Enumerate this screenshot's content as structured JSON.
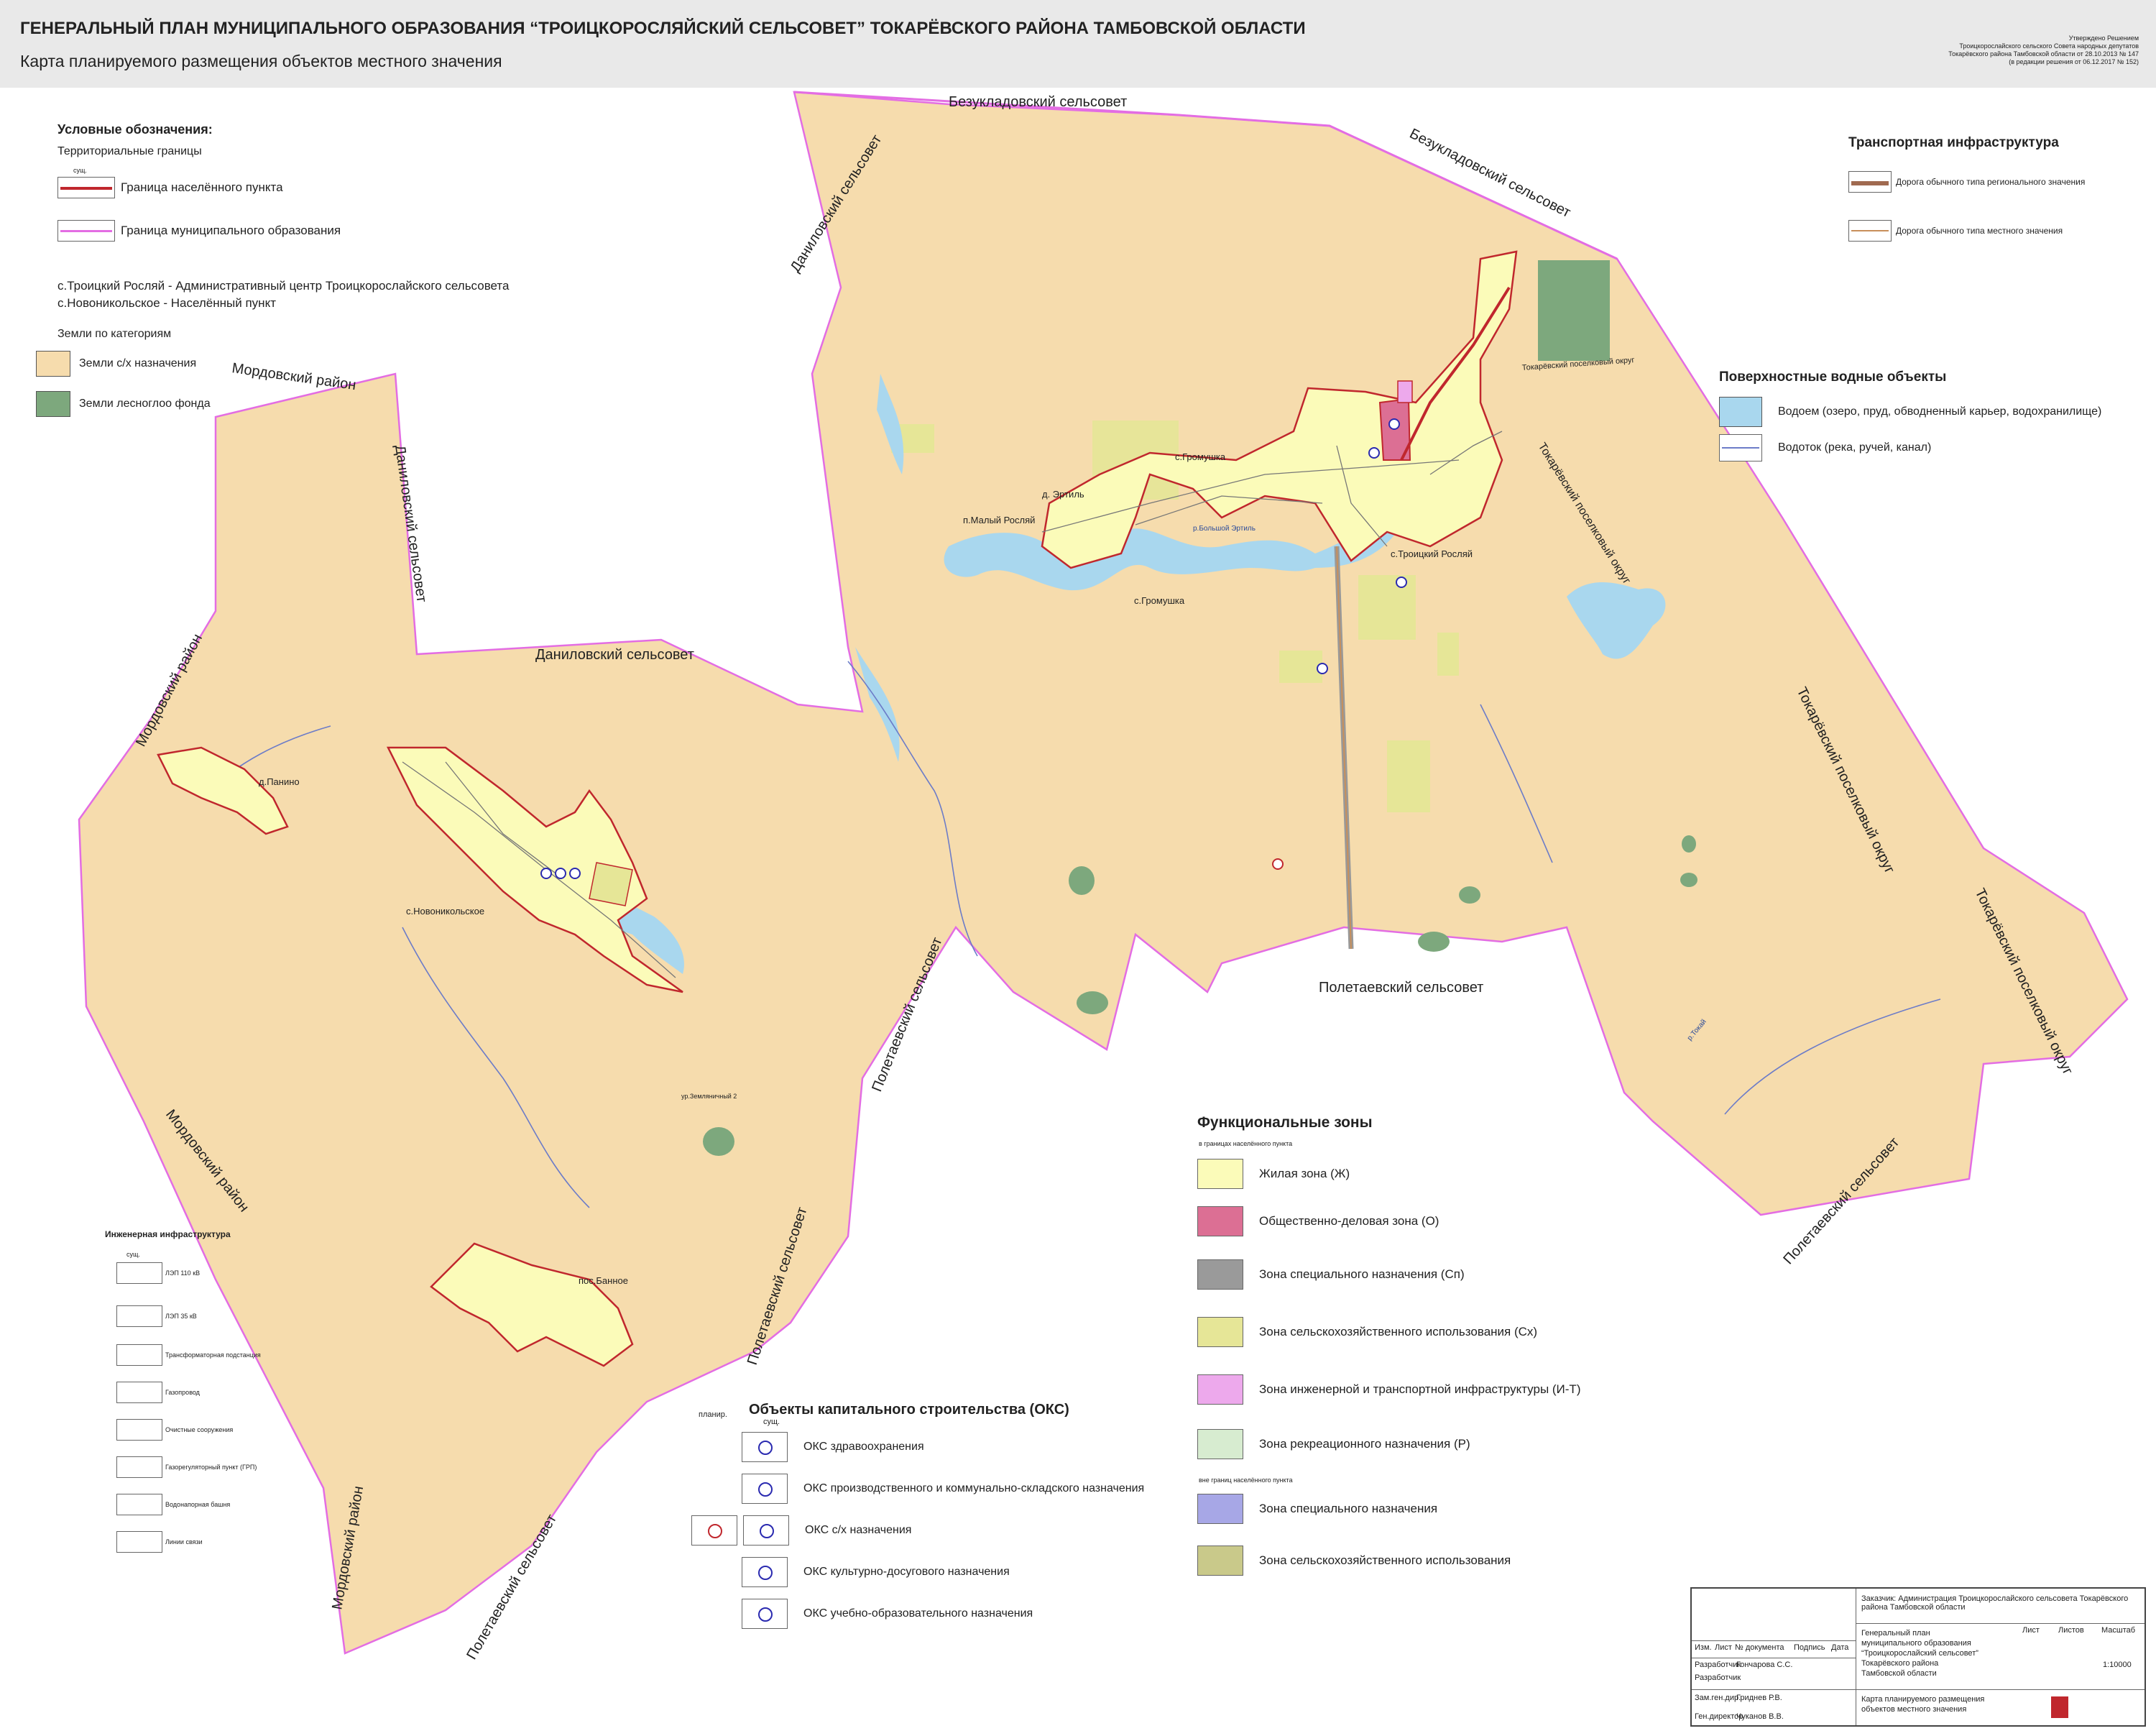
{
  "header": {
    "title": "ГЕНЕРАЛЬНЫЙ ПЛАН МУНИЦИПАЛЬНОГО ОБРАЗОВАНИЯ “ТРОИЦКОРОСЛЯЙСКИЙ СЕЛЬСОВЕТ” ТОКАРЁВСКОГО РАЙОНА ТАМБОВСКОЙ ОБЛАСТИ",
    "subtitle": "Карта планируемого размещения объектов местного значения",
    "approval": [
      "Утверждено Решением",
      "Троицкорослайского сельского Совета народных депутатов",
      "Токарёвского района Тамбовской области от 28.10.2013 № 147",
      "(в редакции решения от 06.12.2017 № 152)"
    ]
  },
  "legend_left": {
    "heading": "Условные обозначения:",
    "territorial": "Территориальные границы",
    "col_note": "сущ.",
    "settlement_border": "Граница населённого пункта",
    "municipal_border": "Граница муниципального образования",
    "center_note": "с.Троицкий Росляй - Административный центр Троицкорослайского сельсовета",
    "settlement_note": "с.Новоникольское - Населённый пункт",
    "land_heading": "Земли по категориям",
    "agri_land": "Земли с/х назначения",
    "forest_land": "Земли лесноглоо фонда"
  },
  "transport": {
    "heading": "Транспортная инфраструктура",
    "regional_road": "Дорога обычного типа регионального значения",
    "local_road": "Дорога обычного типа местного значения"
  },
  "water": {
    "heading": "Поверхностные водные объекты",
    "reservoir": "Водоем (озеро, пруд, обводненный карьер, водохранилище)",
    "stream": "Водоток (река, ручей, канал)"
  },
  "zones": {
    "heading": "Функциональные зоны",
    "inside_note": "в границах населённого пункта",
    "outside_note": "вне границ населённого пункта",
    "items": [
      {
        "label": "Жилая зона (Ж)",
        "color": "#fbfbb9"
      },
      {
        "label": "Общественно-деловая зона (О)",
        "color": "#dc6f94"
      },
      {
        "label": "Зона специального назначения (Сп)",
        "color": "#9a9a9a"
      },
      {
        "label": "Зона сельскохозяйственного использования (Сх)",
        "color": "#e6e697"
      },
      {
        "label": "Зона инженерной и транспортной инфраструктуры (И-Т)",
        "color": "#eda9ec"
      },
      {
        "label": "Зона рекреационного назначения (Р)",
        "color": "#d7ecd0"
      }
    ],
    "outside_items": [
      {
        "label": "Зона специального назначения",
        "color": "#a7a7e6"
      },
      {
        "label": "Зона сельскохозяйственного использования",
        "color": "#c9c98a"
      }
    ]
  },
  "oks": {
    "heading": "Объекты капитального строительства (ОКС)",
    "planned": "планир.",
    "existing": "сущ.",
    "items": [
      "ОКС здравоохранения",
      "ОКС производственного и коммунально-складского назначения",
      "ОКС с/х назначения",
      "ОКС культурно-досугового назначения",
      "ОКС учебно-образовательного назначения"
    ]
  },
  "engineering": {
    "heading": "Инженерная инфраструктура",
    "col": "сущ.",
    "items": [
      "ЛЭП 110 кВ",
      "ЛЭП 35 кВ",
      "Трансформаторная подстанция",
      "Газопровод",
      "Очистные сооружения",
      "Газорегуляторный пункт (ГРП)",
      "Водонапорная башня",
      "Линии связи"
    ]
  },
  "map_labels": {
    "bezukladovsky_top": "Безукладовский сельсовет",
    "bezukladovsky_ne": "Безукладовский сельсовет",
    "danilovsky_n": "Даниловский сельсовет",
    "danilovsky_mid": "Даниловский сельсовет",
    "danilovsky_vert": "Даниловский сельсовет",
    "mordovsky_1": "Мордовский район",
    "mordovsky_2": "Мордовский район",
    "mordovsky_3": "Мордовский район",
    "mordovsky_4": "Мордовский район",
    "poletaevsky_1": "Полетаевский сельсовет",
    "poletaevsky_2": "Полетаевский сельсовет",
    "poletaevsky_3": "Полетаевский сельсовет",
    "poletaevsky_4": "Полетаевский сельсовет",
    "poletaevsky_5": "Полетаевский сельсовет",
    "tokarev_1": "Токарёвский поселковый округ",
    "tokarev_2": "Токарёвский поселковый округ",
    "tokarev_3": "Токарёвский поселковый округ",
    "tokarev_4": "Токарёвский поселковый округ",
    "troitsky": "с.Троицкий Росляй",
    "gromushka_1": "с.Громушка",
    "gromushka_2": "с.Громушка",
    "ertil": "д. Эртиль",
    "maly_roslyay": "п.Малый Росляй",
    "panino": "д.Панино",
    "novonikolskoe": "с.Новоникольское",
    "bannoe": "пос.Банное",
    "zemlyanichny": "ур.Земляничный 2",
    "river_erttil": "р.Большой Эртиль",
    "river_tokay": "р.Токай"
  },
  "stamp": {
    "customer": "Заказчик: Администрация Троицкорослайского сельсовета Токарёвского района Тамбовской области",
    "project": [
      "Генеральный план",
      "муниципального образования",
      "“Троицкорослайский сельсовет”",
      "Токарёвского района",
      "Тамбовской области"
    ],
    "sheet_title": [
      "Карта планируемого размещения",
      "объектов местного значения"
    ],
    "sheet": "Лист",
    "sheets": "Листов",
    "scale_label": "Масштаб",
    "scale": "1:10000",
    "cols": [
      "Изм.",
      "Лист",
      "№ документа",
      "Подпись",
      "Дата"
    ],
    "roles": [
      {
        "role": "Разработчик",
        "name": "Гончарова С.С."
      },
      {
        "role": "Разработчик",
        "name": ""
      },
      {
        "role": "Зам.ген.дир.",
        "name": "Гриднев Р.В."
      },
      {
        "role": "Ген.директор",
        "name": "Чуканов В.В."
      }
    ]
  }
}
